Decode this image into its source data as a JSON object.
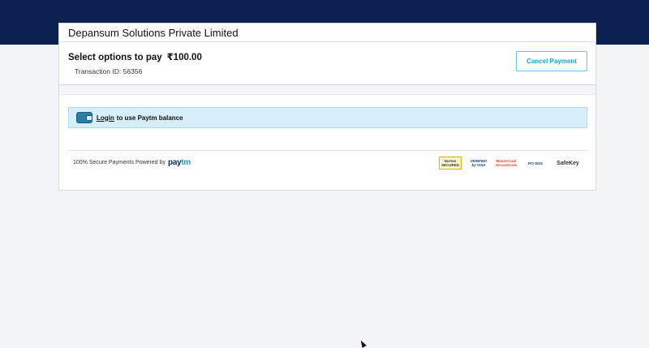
{
  "header": {
    "merchant_name": "Depansum Solutions Private Limited"
  },
  "summary": {
    "title": "Select options to pay",
    "amount": "₹100.00",
    "transaction_id": "Transaction ID: 56356",
    "cancel_label": "Cancel Payment"
  },
  "login_strip": {
    "link_label": "Login",
    "text": "to use Paytm balance"
  },
  "footer": {
    "secure_text": "100% Secure Payments Powered by",
    "logo_pay": "pay",
    "logo_tm": "tm"
  },
  "trust_badges": [
    {
      "label": "Norton SECURED",
      "icon": "norton-badge"
    },
    {
      "label": "VERIFIED by VISA",
      "icon": "visa-badge"
    },
    {
      "label": "MasterCard SecureCode",
      "icon": "mastercard-badge"
    },
    {
      "label": "PCI DSS",
      "icon": "pci-dss-badge"
    },
    {
      "label": "SafeKey",
      "icon": "safekey-badge"
    }
  ],
  "colors": {
    "topbar": "#0c2150",
    "accent": "#1ea1d8",
    "login_strip_bg": "#d7effa"
  }
}
